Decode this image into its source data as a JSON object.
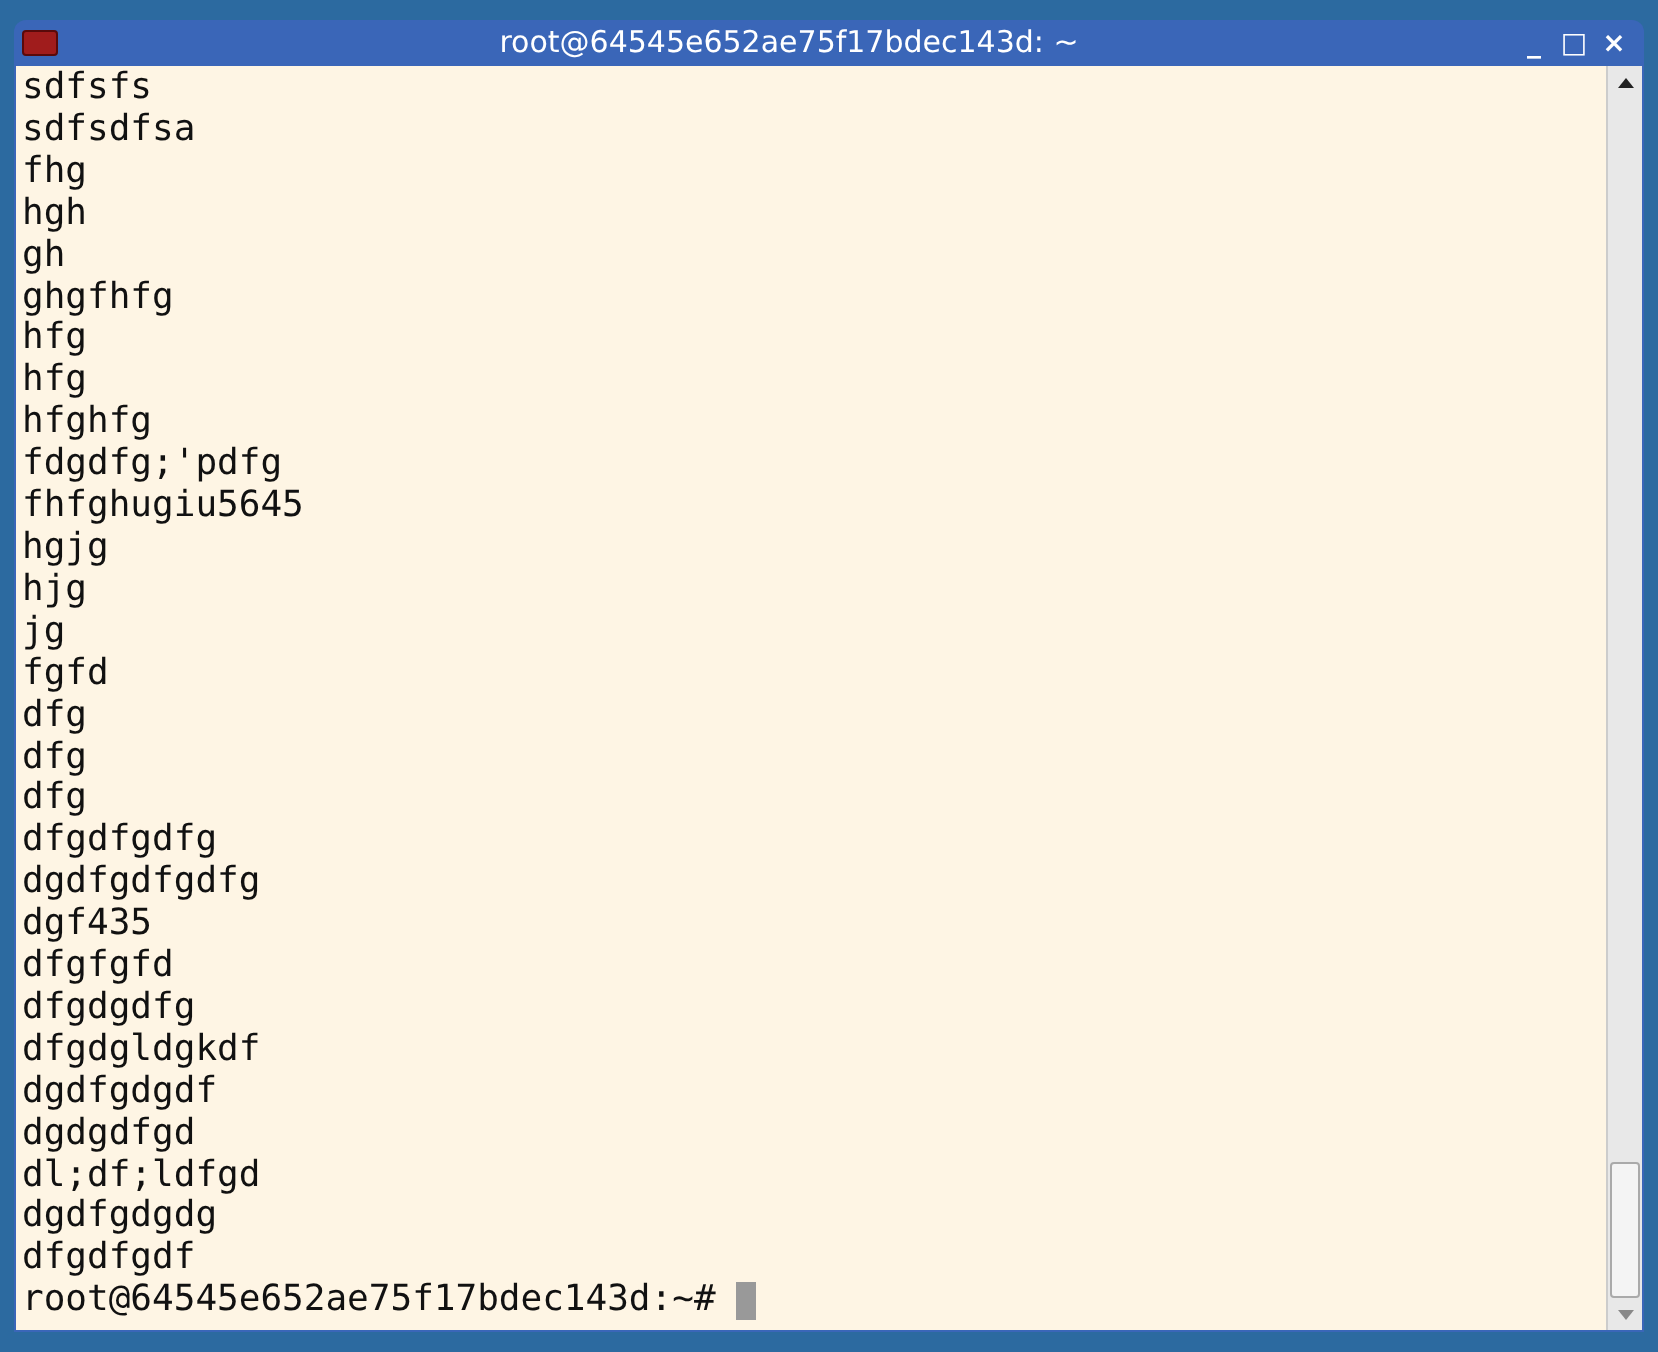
{
  "window": {
    "title": "root@64545e652ae75f17bdec143d: ~",
    "controls": [
      "_",
      "□",
      "×"
    ]
  },
  "terminal": {
    "lines": [
      "sdfsfs",
      "sdfsdfsa",
      "fhg",
      "hgh",
      "gh",
      "ghgfhfg",
      "hfg",
      "hfg",
      "hfghfg",
      "fdgdfg;'pdfg",
      "fhfghugiu5645",
      "hgjg",
      "hjg",
      "jg",
      "fgfd",
      "dfg",
      "dfg",
      "dfg",
      "dfgdfgdfg",
      "dgdfgdfgdfg",
      "dgf435",
      "dfgfgfd",
      "dfgdgdfg",
      "dfgdgldgkdf",
      "dgdfgdgdf",
      "dgdgdfgd",
      "dl;df;ldfgd",
      "dgdfgdgdg",
      "dfgdfgdf"
    ],
    "prompt": "root@64545e652ae75f17bdec143d:~#"
  }
}
